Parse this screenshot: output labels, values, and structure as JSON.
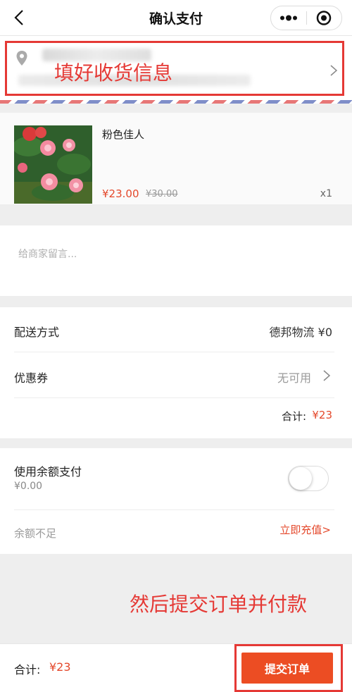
{
  "nav": {
    "title": "确认支付",
    "back_icon": "chevron-left-icon",
    "more_icon": "more-dots-icon",
    "close_icon": "target-circle-icon"
  },
  "address": {
    "annotation": "填好收货信息",
    "pin_icon": "location-pin-icon"
  },
  "product": {
    "name": "粉色佳人",
    "price": "¥23.00",
    "original_price": "¥30.00",
    "quantity": "x1"
  },
  "note": {
    "placeholder": "给商家留言..."
  },
  "delivery": {
    "label": "配送方式",
    "value": "德邦物流 ¥0"
  },
  "coupon": {
    "label": "优惠券",
    "value": "无可用"
  },
  "subtotal": {
    "label": "合计:",
    "value": "¥23"
  },
  "balance": {
    "label": "使用余额支付",
    "amount": "¥0.00",
    "enabled": false,
    "insufficient": "余额不足",
    "recharge": "立即充值>"
  },
  "tip": {
    "annotation": "然后提交订单并付款"
  },
  "footer": {
    "total_label": "合计:",
    "total_value": "¥23",
    "submit": "提交订单"
  },
  "colors": {
    "accent": "#e4482b",
    "annotation": "#e53935",
    "submit_bg": "#ec4d23"
  }
}
